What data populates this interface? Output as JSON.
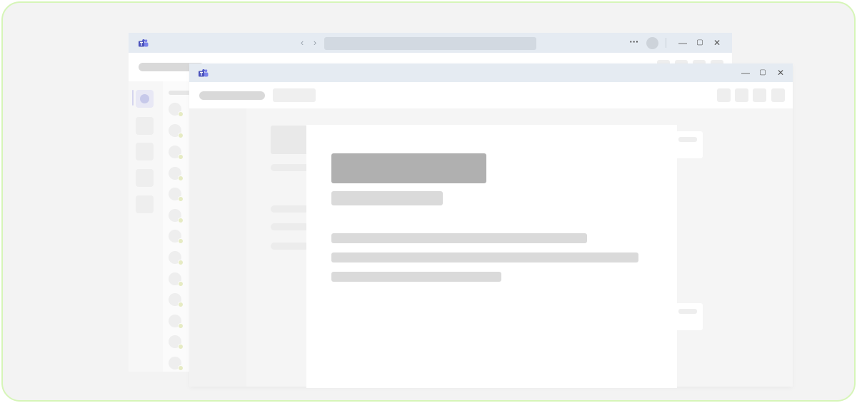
{
  "theme": {
    "frame_border": "#d6f5b8",
    "frame_bg": "#f3f3f3",
    "titlebar_bg": "#e5ebf2",
    "teams_logo_color": "#5059c9",
    "skeleton_dark": "#b0b0b0",
    "skeleton_light": "#dadada"
  },
  "back_window": {
    "titlebar": {
      "logo_icon": "teams-logo-icon",
      "back_glyph": "‹",
      "forward_glyph": "›",
      "more_glyph": "···",
      "minimize_glyph": "—",
      "maximize_glyph": "▢",
      "close_glyph": "✕"
    },
    "rail_icons": [
      "chat-icon",
      "rail-placeholder-icon",
      "rail-placeholder-icon",
      "rail-placeholder-icon",
      "rail-placeholder-icon"
    ]
  },
  "front_window": {
    "titlebar": {
      "logo_icon": "teams-logo-icon",
      "minimize_glyph": "—",
      "maximize_glyph": "▢",
      "close_glyph": "✕"
    }
  }
}
